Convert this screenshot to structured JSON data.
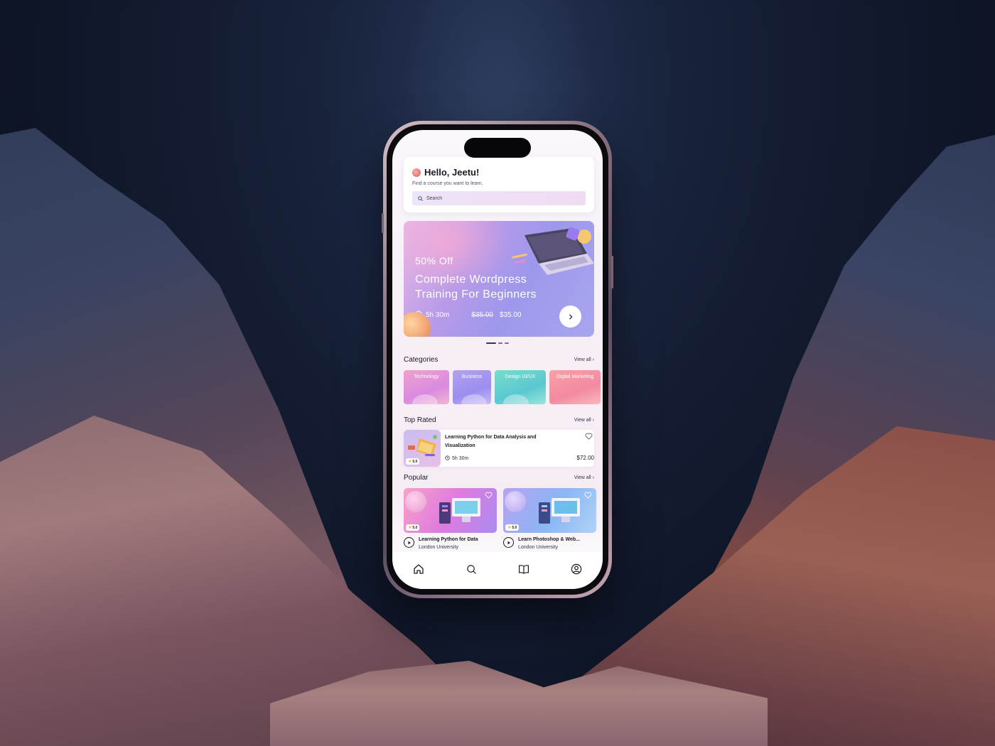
{
  "header": {
    "greeting": "Hello, Jeetu!",
    "subtitle": "Find a course you want to learn.",
    "search_placeholder": "Search"
  },
  "banner": {
    "discount": "50% Off",
    "title": "Complete Wordpress Training For Beginners",
    "duration": "5h 30m",
    "old_price": "$35.00",
    "new_price": "$35.00",
    "slide_count": 3,
    "active_slide": 1
  },
  "categories": {
    "title": "Categories",
    "view_all": "View all",
    "items": [
      {
        "label": "Technology"
      },
      {
        "label": "Business"
      },
      {
        "label": "Design UI/UX"
      },
      {
        "label": "Digital Marketing"
      }
    ]
  },
  "top_rated": {
    "title": "Top Rated",
    "view_all": "View all",
    "course": {
      "title": "Learning Python for Data Analysis and Visualization",
      "rating": "5.0",
      "duration": "5h 30m",
      "price": "$72.00"
    }
  },
  "popular": {
    "title": "Popular",
    "view_all": "View all",
    "items": [
      {
        "title": "Learning Python for Data",
        "university": "London University",
        "rating": "5.0"
      },
      {
        "title": "Learn Photoshop & Web...",
        "university": "London University",
        "rating": "5.0"
      }
    ]
  },
  "tabbar": {
    "items": [
      "home-icon",
      "search-icon",
      "book-icon",
      "profile-icon"
    ]
  },
  "colors": {
    "accent": "#9e98ec",
    "text": "#1a1a24",
    "background": "#141d33"
  }
}
